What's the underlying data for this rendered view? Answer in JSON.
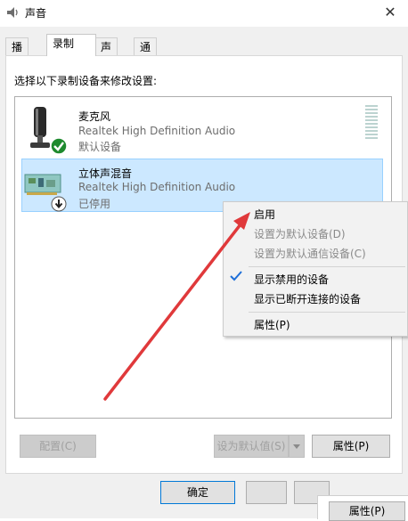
{
  "window": {
    "title": "声音",
    "close_symbol": "✕"
  },
  "tabs": [
    {
      "label": "播放"
    },
    {
      "label": "录制"
    },
    {
      "label": "声音"
    },
    {
      "label": "通信"
    }
  ],
  "instruction": "选择以下录制设备来修改设置:",
  "devices": [
    {
      "name": "麦克风",
      "driver": "Realtek High Definition Audio",
      "status": "默认设备",
      "icon": "microphone-icon",
      "badge": "default-check-icon"
    },
    {
      "name": "立体声混音",
      "driver": "Realtek High Definition Audio",
      "status": "已停用",
      "icon": "sound-card-icon",
      "badge": "disabled-arrow-icon",
      "selected": true
    }
  ],
  "buttons": {
    "configure": "配置(C)",
    "set_default": "设为默认值(S)",
    "properties": "属性(P)",
    "ok": "确定",
    "properties_bottom": "属性(P)"
  },
  "context_menu": {
    "items": [
      {
        "label": "启用",
        "enabled": true
      },
      {
        "label": "设置为默认设备(D)",
        "enabled": false
      },
      {
        "label": "设置为默认通信设备(C)",
        "enabled": false
      },
      {
        "label": "显示禁用的设备",
        "enabled": true,
        "checked": true
      },
      {
        "label": "显示已断开连接的设备",
        "enabled": true
      },
      {
        "label": "属性(P)",
        "enabled": true
      }
    ]
  },
  "colors": {
    "selection": "#cce8ff",
    "selection_border": "#99d1ff",
    "annotation_arrow": "#e0393b",
    "check_green": "#1e8a2e",
    "check_blue": "#1e6fd8"
  }
}
